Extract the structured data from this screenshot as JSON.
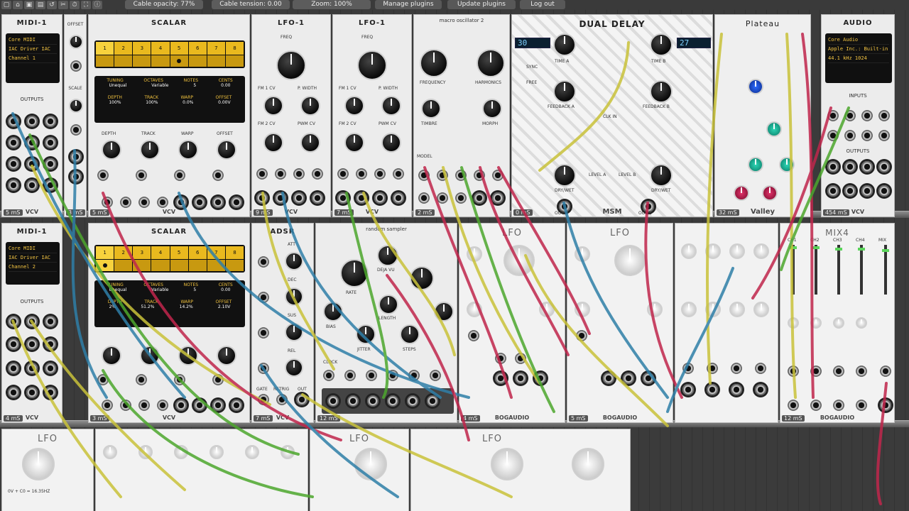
{
  "toolbar": {
    "cable_opacity": "Cable opacity: 77%",
    "cable_tension": "Cable tension: 0.00",
    "zoom": "Zoom: 100%",
    "manage_plugins": "Manage plugins",
    "update_plugins": "Update plugins",
    "log_out": "Log out"
  },
  "modules_top": {
    "midi1": {
      "title": "MIDI-1",
      "lcd": [
        "Core MIDI",
        "IAC Driver IAC",
        "Channel 1"
      ],
      "outputs": "OUTPUTS",
      "brand": "VCV",
      "ms": "5 mS"
    },
    "offset_a": {
      "title": "OFFSET",
      "scale": "SCALE",
      "ms": "3 mS"
    },
    "scalar1": {
      "title": "SCALAR",
      "steps": [
        "1",
        "2",
        "3",
        "4",
        "5",
        "6",
        "7",
        "8"
      ],
      "tuning": "TUNING",
      "octaves": "OCTAVES",
      "notes": "NOTES",
      "cents": "CENTS",
      "tuning_v": "Unequal",
      "octaves_v": "Variable",
      "notes_v": "5",
      "cents_v": "0.00",
      "depth": "DEPTH",
      "track": "TRACK",
      "warp": "WARP",
      "offset": "OFFSET",
      "depth_v": "100%",
      "track_v": "100%",
      "warp_v": "0.0%",
      "offset_v": "0.00V",
      "brand": "VCV",
      "ms": "5 mS"
    },
    "lfo1a": {
      "title": "LFO-1",
      "freq": "FREQ",
      "fm1": "FM 1 CV",
      "pw": "P. WIDTH",
      "fm2": "FM 2 CV",
      "pwm": "PWM CV",
      "ms": "9 mS",
      "brand": "VCV"
    },
    "lfo1b": {
      "title": "LFO-1",
      "freq": "FREQ",
      "fm1": "FM 1 CV",
      "pw": "P. WIDTH",
      "fm2": "FM 2 CV",
      "pwm": "PWM CV",
      "ms": "7 mS",
      "brand": "VCV"
    },
    "macro": {
      "title": "macro oscillator 2",
      "frequency": "FREQUENCY",
      "harmonics": "HARMONICS",
      "timbre": "TIMBRE",
      "morph": "MORPH",
      "model": "MODEL",
      "ms": "2 mS"
    },
    "delay": {
      "title": "DUAL DELAY",
      "disp_a": "30",
      "disp_b": "27",
      "time_a": "TIME A",
      "time_b": "TIME B",
      "feedback_a": "FEEDBACK A",
      "feedback_b": "FEEDBACK B",
      "sync": "SYNC",
      "free": "FREE",
      "clk_in": "CLK IN",
      "level_a": "LEVEL A",
      "level_b": "LEVEL B",
      "drywet": "DRY/WET",
      "out_a": "OUT A",
      "out_b": "OUT B",
      "brand": "MSM",
      "ms": "0 mS"
    },
    "plateau": {
      "title": "Plateau",
      "brand": "Valley",
      "ms": "32 mS"
    },
    "audio": {
      "title": "AUDIO",
      "lcd": [
        "Core Audio",
        "Apple Inc.: Built-in",
        "44.1 kHz  1024"
      ],
      "inputs": "INPUTS",
      "outputs": "OUTPUTS",
      "brand": "VCV",
      "ms": "454 mS"
    }
  },
  "modules_bottom": {
    "midi1": {
      "title": "MIDI-1",
      "lcd": [
        "Core MIDI",
        "IAC Driver IAC",
        "Channel 2"
      ],
      "outputs": "OUTPUTS",
      "brand": "VCV",
      "ms": "4 mS"
    },
    "scalar2": {
      "title": "SCALAR",
      "tuning_v": "Unequal",
      "octaves_v": "Variable",
      "notes_v": "5",
      "cents_v": "0.00",
      "depth_v": "2%",
      "track_v": "51.2%",
      "warp_v": "14.2%",
      "offset_v": "2.10V",
      "brand": "VCV",
      "ms": "3 mS"
    },
    "adsr": {
      "title": "ADSR",
      "att": "ATT",
      "dec": "DEC",
      "sus": "SUS",
      "rel": "REL",
      "gate": "GATE",
      "retrig": "RETRIG",
      "out": "OUT",
      "brand": "VCV",
      "ms": "7 mS"
    },
    "random": {
      "title": "random sampler",
      "rate": "RATE",
      "deja_vu": "DEJA VU",
      "length": "LENGTH",
      "steps": "STEPS",
      "bias": "BIAS",
      "jitter": "JITTER",
      "clock": "CLOCK",
      "ms": "12 mS"
    },
    "lfo_bog1": {
      "title": "LFO",
      "brand": "BOGAUDIO",
      "ms": "4 mS"
    },
    "lfo_bog2": {
      "title": "LFO",
      "brand": "BOGAUDIO",
      "ms": "5 mS"
    },
    "mix4": {
      "title": "MIX4",
      "brand": "BOGAUDIO",
      "ms": "12 mS",
      "channels": [
        "CH1",
        "CH2",
        "CH3",
        "CH4",
        "MIX"
      ]
    }
  },
  "modules_row3": {
    "lfo_a": {
      "title": "LFO",
      "range": "0V + C0 = 16.35HZ"
    },
    "lfo_b": {
      "title": "LFO"
    },
    "lfo_c": {
      "title": "LFO"
    }
  },
  "colors": {
    "cable_yellow": "#c9c23a",
    "cable_red": "#c0264c",
    "cable_blue": "#2f7fa8",
    "cable_green": "#4da72d",
    "lcd_amber": "#f4c542",
    "scalar_yellow": "#e9b91e"
  }
}
